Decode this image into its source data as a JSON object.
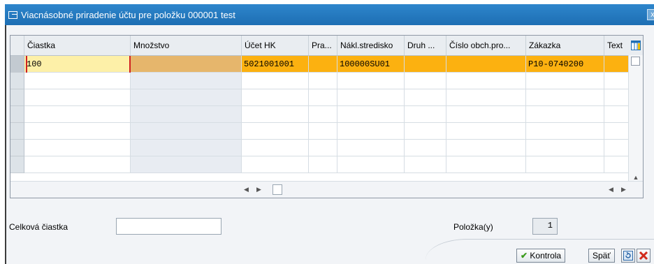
{
  "window": {
    "title": "Viacnásobné priradenie účtu pre položku 000001 test",
    "close_glyph": "x"
  },
  "table": {
    "columns": [
      "Čiastka",
      "Množstvo",
      "Účet HK",
      "Pra...",
      "Nákl.stredisko",
      "Druh ...",
      "Číslo obch.pro...",
      "Zákazka",
      "Text"
    ],
    "rows": [
      [
        "100",
        "",
        "5021001001",
        "",
        "100000SU01",
        "",
        "",
        "P10-0740200",
        ""
      ],
      [
        "",
        "",
        "",
        "",
        "",
        "",
        "",
        "",
        ""
      ],
      [
        "",
        "",
        "",
        "",
        "",
        "",
        "",
        "",
        ""
      ],
      [
        "",
        "",
        "",
        "",
        "",
        "",
        "",
        "",
        ""
      ],
      [
        "",
        "",
        "",
        "",
        "",
        "",
        "",
        "",
        ""
      ],
      [
        "",
        "",
        "",
        "",
        "",
        "",
        "",
        "",
        ""
      ],
      [
        "",
        "",
        "",
        "",
        "",
        "",
        "",
        "",
        ""
      ]
    ],
    "layout_icon": "column-layout-icon"
  },
  "form": {
    "total_label": "Celková čiastka",
    "total_value": "",
    "items_label": "Položka(y)",
    "items_value": "1"
  },
  "actions": {
    "check_label": "Kontrola",
    "back_label": "Späť",
    "refresh_icon": "refresh-icon",
    "cancel_icon": "cancel-icon"
  },
  "colors": {
    "titlebar": "#1d6eb3",
    "selected_row": "#fcb110",
    "focus_border": "#d02020"
  }
}
